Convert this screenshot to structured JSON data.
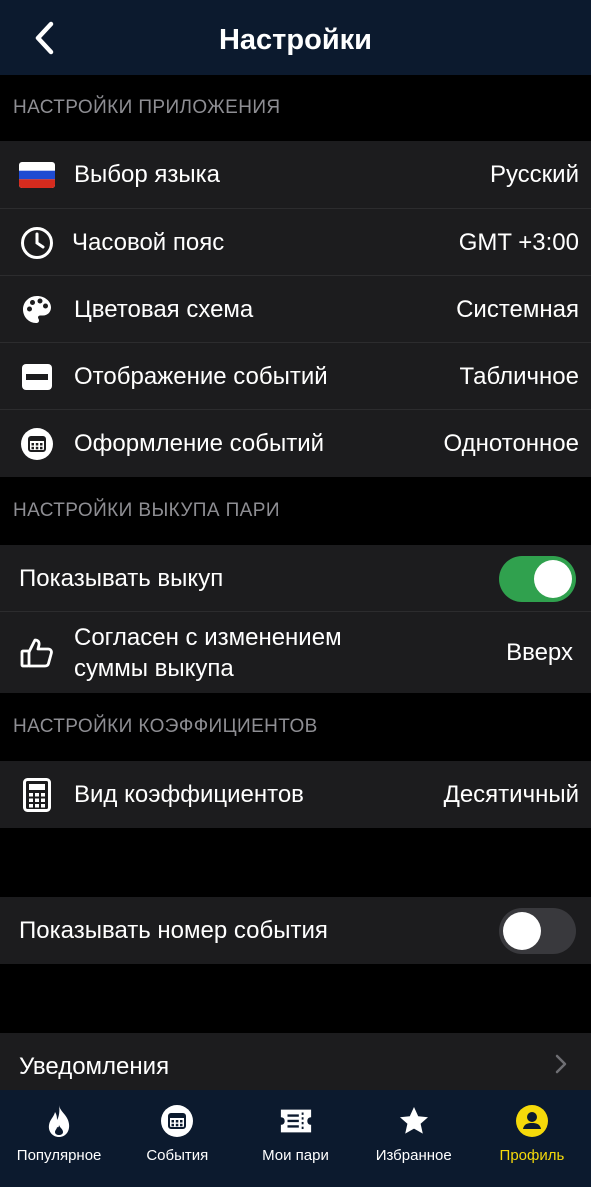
{
  "header": {
    "title": "Настройки",
    "back_icon": "chevron-left-icon"
  },
  "sections": {
    "app": "НАСТРОЙКИ ПРИЛОЖЕНИЯ",
    "cashout": "НАСТРОЙКИ ВЫКУПА ПАРИ",
    "odds": "НАСТРОЙКИ КОЭФФИЦИЕНТОВ"
  },
  "app_settings": [
    {
      "label": "Выбор языка",
      "value": "Русский",
      "icon": "russian-flag-icon"
    },
    {
      "label": "Часовой пояс",
      "value": "GMT +3:00",
      "icon": "clock-icon"
    },
    {
      "label": "Цветовая схема",
      "value": "Системная",
      "icon": "palette-icon"
    },
    {
      "label": "Отображение событий",
      "value": "Табличное",
      "icon": "table-view-icon"
    },
    {
      "label": "Оформление событий",
      "value": "Однотонное",
      "icon": "calendar-style-icon"
    }
  ],
  "cashout": {
    "show_label": "Показывать выкуп",
    "show_enabled": true,
    "agree_label_line1": "Согласен с изменением",
    "agree_label_line2": "суммы выкупа",
    "agree_value": "Вверх",
    "agree_icon": "thumbs-up-icon"
  },
  "odds": {
    "label": "Вид коэффициентов",
    "value": "Десятичный",
    "icon": "calculator-icon"
  },
  "event_number": {
    "label": "Показывать номер события",
    "enabled": false
  },
  "notifications": {
    "label": "Уведомления",
    "icon": "chevron-right-icon"
  },
  "tabbar": [
    {
      "label": "Популярное",
      "icon": "flame-icon",
      "active": false
    },
    {
      "label": "События",
      "icon": "calendar-icon",
      "active": false
    },
    {
      "label": "Мои пари",
      "icon": "ticket-icon",
      "active": false
    },
    {
      "label": "Избранное",
      "icon": "star-icon",
      "active": false
    },
    {
      "label": "Профиль",
      "icon": "profile-icon",
      "active": true
    }
  ],
  "colors": {
    "header_bg": "#0c1a2e",
    "row_bg": "#1c1c1e",
    "toggle_on": "#30a14e",
    "active_tab": "#f5d90a"
  }
}
